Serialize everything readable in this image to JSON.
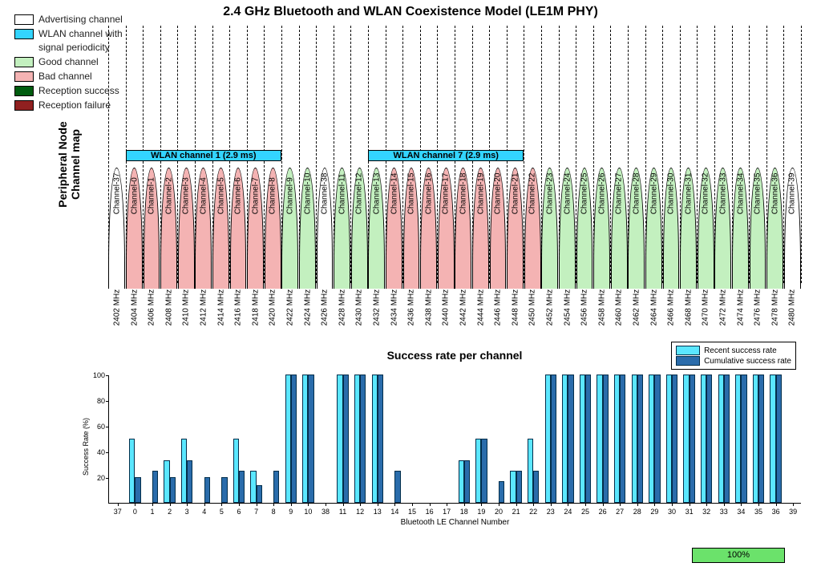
{
  "title": "2.4 GHz Bluetooth and WLAN Coexistence Model (LE1M PHY)",
  "legend": {
    "adv": "Advertising channel",
    "wlan": "WLAN channel with\nsignal periodicity",
    "good": "Good channel",
    "bad": "Bad channel",
    "rs": "Reception success",
    "rf": "Reception failure"
  },
  "channel_map": {
    "ylabel": "Peripheral Node\nChannel map",
    "wlan_bars": [
      {
        "label": "WLAN channel 1 (2.9 ms)",
        "from_slot": 1,
        "to_slot": 10
      },
      {
        "label": "WLAN channel 7 (2.9 ms)",
        "from_slot": 15,
        "to_slot": 24
      }
    ],
    "channels": [
      {
        "id": 37,
        "label": "Channel-37",
        "freq": "2402 MHz",
        "type": "adv"
      },
      {
        "id": 0,
        "label": "Channel-0",
        "freq": "2404 MHz",
        "type": "bad"
      },
      {
        "id": 1,
        "label": "Channel-1",
        "freq": "2406 MHz",
        "type": "bad"
      },
      {
        "id": 2,
        "label": "Channel-2",
        "freq": "2408 MHz",
        "type": "bad"
      },
      {
        "id": 3,
        "label": "Channel-3",
        "freq": "2410 MHz",
        "type": "bad"
      },
      {
        "id": 4,
        "label": "Channel-4",
        "freq": "2412 MHz",
        "type": "bad"
      },
      {
        "id": 5,
        "label": "Channel-5",
        "freq": "2414 MHz",
        "type": "bad"
      },
      {
        "id": 6,
        "label": "Channel-6",
        "freq": "2416 MHz",
        "type": "bad"
      },
      {
        "id": 7,
        "label": "Channel-7",
        "freq": "2418 MHz",
        "type": "bad"
      },
      {
        "id": 8,
        "label": "Channel-8",
        "freq": "2420 MHz",
        "type": "bad"
      },
      {
        "id": 9,
        "label": "Channel-9",
        "freq": "2422 MHz",
        "type": "good"
      },
      {
        "id": 10,
        "label": "Channel-10",
        "freq": "2424 MHz",
        "type": "good"
      },
      {
        "id": 38,
        "label": "Channel-38",
        "freq": "2426 MHz",
        "type": "adv"
      },
      {
        "id": 11,
        "label": "Channel-11",
        "freq": "2428 MHz",
        "type": "good"
      },
      {
        "id": 12,
        "label": "Channel-12",
        "freq": "2430 MHz",
        "type": "good"
      },
      {
        "id": 13,
        "label": "Channel-13",
        "freq": "2432 MHz",
        "type": "good"
      },
      {
        "id": 14,
        "label": "Channel-14",
        "freq": "2434 MHz",
        "type": "bad"
      },
      {
        "id": 15,
        "label": "Channel-15",
        "freq": "2436 MHz",
        "type": "bad"
      },
      {
        "id": 16,
        "label": "Channel-16",
        "freq": "2438 MHz",
        "type": "bad"
      },
      {
        "id": 17,
        "label": "Channel-17",
        "freq": "2440 MHz",
        "type": "bad"
      },
      {
        "id": 18,
        "label": "Channel-18",
        "freq": "2442 MHz",
        "type": "bad"
      },
      {
        "id": 19,
        "label": "Channel-19",
        "freq": "2444 MHz",
        "type": "bad"
      },
      {
        "id": 20,
        "label": "Channel-20",
        "freq": "2446 MHz",
        "type": "bad"
      },
      {
        "id": 21,
        "label": "Channel-21",
        "freq": "2448 MHz",
        "type": "bad"
      },
      {
        "id": 22,
        "label": "Channel-22",
        "freq": "2450 MHz",
        "type": "bad"
      },
      {
        "id": 23,
        "label": "Channel-23",
        "freq": "2452 MHz",
        "type": "good"
      },
      {
        "id": 24,
        "label": "Channel-24",
        "freq": "2454 MHz",
        "type": "good"
      },
      {
        "id": 25,
        "label": "Channel-25",
        "freq": "2456 MHz",
        "type": "good"
      },
      {
        "id": 26,
        "label": "Channel-26",
        "freq": "2458 MHz",
        "type": "good"
      },
      {
        "id": 27,
        "label": "Channel-27",
        "freq": "2460 MHz",
        "type": "good"
      },
      {
        "id": 28,
        "label": "Channel-28",
        "freq": "2462 MHz",
        "type": "good"
      },
      {
        "id": 29,
        "label": "Channel-29",
        "freq": "2464 MHz",
        "type": "good"
      },
      {
        "id": 30,
        "label": "Channel-30",
        "freq": "2466 MHz",
        "type": "good"
      },
      {
        "id": 31,
        "label": "Channel-31",
        "freq": "2468 MHz",
        "type": "good"
      },
      {
        "id": 32,
        "label": "Channel-32",
        "freq": "2470 MHz",
        "type": "good"
      },
      {
        "id": 33,
        "label": "Channel-33",
        "freq": "2472 MHz",
        "type": "good"
      },
      {
        "id": 34,
        "label": "Channel-34",
        "freq": "2474 MHz",
        "type": "good"
      },
      {
        "id": 35,
        "label": "Channel-35",
        "freq": "2476 MHz",
        "type": "good"
      },
      {
        "id": 36,
        "label": "Channel-36",
        "freq": "2478 MHz",
        "type": "good"
      },
      {
        "id": 39,
        "label": "Channel-39",
        "freq": "2480 MHz",
        "type": "adv"
      }
    ]
  },
  "bar_chart": {
    "title": "Success rate per channel",
    "ylabel": "Success Rate (%)",
    "xlabel": "Bluetooth LE Channel Number",
    "legend": {
      "recent": "Recent success rate",
      "cumulative": "Cumulative success rate"
    },
    "yticks": [
      0,
      20,
      40,
      60,
      80,
      100
    ]
  },
  "progress": {
    "label": "100%"
  },
  "chart_data": {
    "type": "bar",
    "title": "Success rate per channel",
    "xlabel": "Bluetooth LE Channel Number",
    "ylabel": "Success Rate (%)",
    "ylim": [
      0,
      100
    ],
    "categories": [
      37,
      0,
      1,
      2,
      3,
      4,
      5,
      6,
      7,
      8,
      9,
      10,
      38,
      11,
      12,
      13,
      14,
      15,
      16,
      17,
      18,
      19,
      20,
      21,
      22,
      23,
      24,
      25,
      26,
      27,
      28,
      29,
      30,
      31,
      32,
      33,
      34,
      35,
      36,
      39
    ],
    "series": [
      {
        "name": "Recent success rate",
        "values": [
          0,
          50,
          0,
          33,
          50,
          0,
          0,
          50,
          25,
          0,
          100,
          100,
          0,
          100,
          100,
          100,
          0,
          0,
          0,
          0,
          33,
          50,
          0,
          25,
          50,
          100,
          100,
          100,
          100,
          100,
          100,
          100,
          100,
          100,
          100,
          100,
          100,
          100,
          100,
          0
        ]
      },
      {
        "name": "Cumulative success rate",
        "values": [
          0,
          20,
          25,
          20,
          33,
          20,
          20,
          25,
          14,
          25,
          100,
          100,
          0,
          100,
          100,
          100,
          25,
          0,
          0,
          0,
          33,
          50,
          17,
          25,
          25,
          100,
          100,
          100,
          100,
          100,
          100,
          100,
          100,
          100,
          100,
          100,
          100,
          100,
          100,
          0
        ]
      }
    ]
  }
}
